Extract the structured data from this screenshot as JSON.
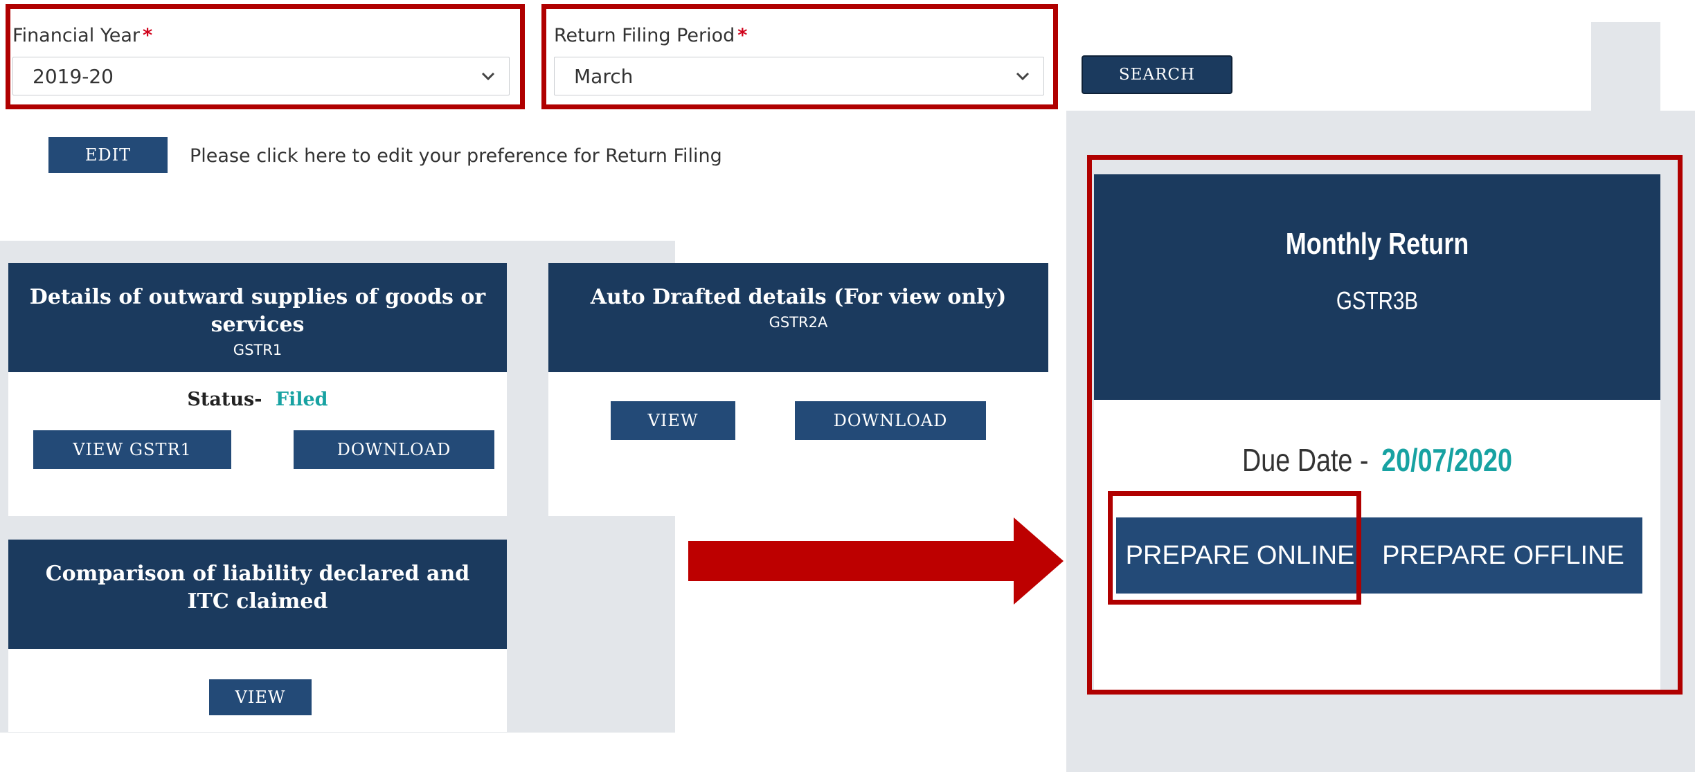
{
  "filters": {
    "financial_year": {
      "label": "Financial Year",
      "required_mark": "*",
      "value": "2019-20"
    },
    "return_period": {
      "label": "Return Filing Period",
      "required_mark": "*",
      "value": "March"
    },
    "search_label": "SEARCH"
  },
  "edit": {
    "button_label": "EDIT",
    "hint": "Please click here to edit your preference for Return Filing"
  },
  "cards": {
    "gstr1": {
      "title": "Details of outward supplies of goods or services",
      "code": "GSTR1",
      "status_label": "Status-",
      "status_value": "Filed",
      "view_label": "VIEW GSTR1",
      "download_label": "DOWNLOAD"
    },
    "gstr2a": {
      "title": "Auto Drafted details (For view only)",
      "code": "GSTR2A",
      "view_label": "VIEW",
      "download_label": "DOWNLOAD"
    },
    "comparison": {
      "title": "Comparison of liability declared and ITC claimed",
      "view_label": "VIEW"
    },
    "gstr3b": {
      "title": "Monthly Return",
      "code": "GSTR3B",
      "due_label": "Due Date -",
      "due_value": "20/07/2020",
      "prepare_online_label": "PREPARE ONLINE",
      "prepare_offline_label": "PREPARE OFFLINE"
    }
  },
  "colors": {
    "navy": "#1b3a5e",
    "button": "#234a77",
    "highlight": "#b00000",
    "status_filed": "#17a2a2",
    "panel_gray": "#e3e6ea"
  }
}
